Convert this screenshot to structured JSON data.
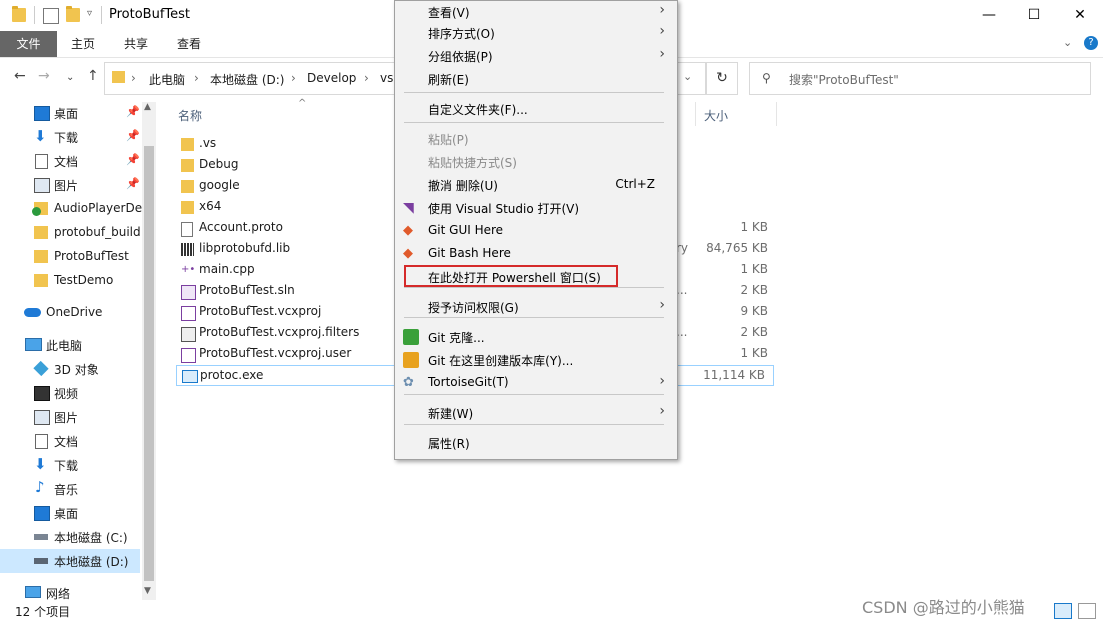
{
  "window": {
    "title": "ProtoBufTest",
    "minimize": "—",
    "maximize": "☐",
    "close": "✕"
  },
  "ribbon": {
    "tabs": [
      "文件",
      "主页",
      "共享",
      "查看"
    ],
    "help": "?"
  },
  "address": {
    "crumbs": [
      "此电脑",
      "本地磁盘 (D:)",
      "Develop",
      "vs"
    ],
    "separator": "›",
    "search_placeholder": "搜索\"ProtoBufTest\""
  },
  "nav": {
    "quick_access": [
      {
        "label": "桌面",
        "icon": "desktop-icon",
        "pinned": true
      },
      {
        "label": "下载",
        "icon": "download-icon",
        "pinned": true
      },
      {
        "label": "文档",
        "icon": "document-icon",
        "pinned": true
      },
      {
        "label": "图片",
        "icon": "picture-icon",
        "pinned": true
      },
      {
        "label": "AudioPlayerDe",
        "icon": "folder-icon",
        "pinned": false
      },
      {
        "label": "protobuf_build",
        "icon": "folder-icon",
        "pinned": false
      },
      {
        "label": "ProtoBufTest",
        "icon": "folder-icon",
        "pinned": false
      },
      {
        "label": "TestDemo",
        "icon": "folder-icon",
        "pinned": false
      }
    ],
    "onedrive": "OneDrive",
    "this_pc": "此电脑",
    "pc_items": [
      {
        "label": "3D 对象",
        "icon": "3d-objects-icon"
      },
      {
        "label": "视频",
        "icon": "video-icon"
      },
      {
        "label": "图片",
        "icon": "picture-icon"
      },
      {
        "label": "文档",
        "icon": "document-icon"
      },
      {
        "label": "下载",
        "icon": "download-icon"
      },
      {
        "label": "音乐",
        "icon": "music-icon"
      },
      {
        "label": "桌面",
        "icon": "desktop-icon"
      },
      {
        "label": "本地磁盘 (C:)",
        "icon": "drive-icon"
      },
      {
        "label": "本地磁盘 (D:)",
        "icon": "drive-icon"
      }
    ],
    "network": "网络"
  },
  "files": {
    "headers": {
      "name": "名称",
      "size": "大小"
    },
    "rows": [
      {
        "name": ".vs",
        "type": "",
        "size": "",
        "icon": "folder-icon"
      },
      {
        "name": "Debug",
        "type": "",
        "size": "",
        "icon": "folder-icon"
      },
      {
        "name": "google",
        "type": "",
        "size": "",
        "icon": "folder-icon"
      },
      {
        "name": "x64",
        "type": "",
        "size": "",
        "icon": "folder-icon"
      },
      {
        "name": "Account.proto",
        "type": "",
        "size": "1 KB",
        "icon": "file-icon"
      },
      {
        "name": "libprotobufd.lib",
        "type": "ry",
        "size": "84,765 KB",
        "icon": "lib-icon"
      },
      {
        "name": "main.cpp",
        "type": "",
        "size": "1 KB",
        "icon": "cpp-icon"
      },
      {
        "name": "ProtoBufTest.sln",
        "type": "...",
        "size": "2 KB",
        "icon": "sln-icon"
      },
      {
        "name": "ProtoBufTest.vcxproj",
        "type": "",
        "size": "9 KB",
        "icon": "vcxproj-icon"
      },
      {
        "name": "ProtoBufTest.vcxproj.filters",
        "type": "...",
        "size": "2 KB",
        "icon": "filters-icon"
      },
      {
        "name": "ProtoBufTest.vcxproj.user",
        "type": "",
        "size": "1 KB",
        "icon": "user-file-icon"
      },
      {
        "name": "protoc.exe",
        "type": "",
        "size": "11,114 KB",
        "icon": "exe-icon"
      }
    ]
  },
  "context_menu": {
    "items": [
      {
        "label": "查看(V)",
        "submenu": true
      },
      {
        "label": "排序方式(O)",
        "submenu": true
      },
      {
        "label": "分组依据(P)",
        "submenu": true
      },
      {
        "label": "刷新(E)"
      },
      {
        "label": "自定义文件夹(F)..."
      },
      {
        "label": "粘贴(P)",
        "disabled": true
      },
      {
        "label": "粘贴快捷方式(S)",
        "disabled": true
      },
      {
        "label": "撤消 删除(U)",
        "shortcut": "Ctrl+Z"
      },
      {
        "label": "使用 Visual Studio 打开(V)",
        "icon": "visual-studio-icon"
      },
      {
        "label": "Git GUI Here",
        "icon": "git-gui-icon"
      },
      {
        "label": "Git Bash Here",
        "icon": "git-bash-icon"
      },
      {
        "label": "在此处打开 Powershell 窗口(S)",
        "highlighted": true
      },
      {
        "label": "授予访问权限(G)",
        "submenu": true
      },
      {
        "label": "Git 克隆...",
        "icon": "git-clone-icon"
      },
      {
        "label": "Git 在这里创建版本库(Y)...",
        "icon": "git-init-icon"
      },
      {
        "label": "TortoiseGit(T)",
        "submenu": true,
        "icon": "tortoisegit-icon"
      },
      {
        "label": "新建(W)",
        "submenu": true
      },
      {
        "label": "属性(R)"
      }
    ]
  },
  "status": {
    "count": "12 个项目"
  },
  "watermark": "CSDN @路过的小熊猫",
  "colors": {
    "accent": "#0078d7",
    "highlight_box": "#d52a2a",
    "selected_nav": "#cce8ff",
    "folder": "#f1c44f"
  }
}
